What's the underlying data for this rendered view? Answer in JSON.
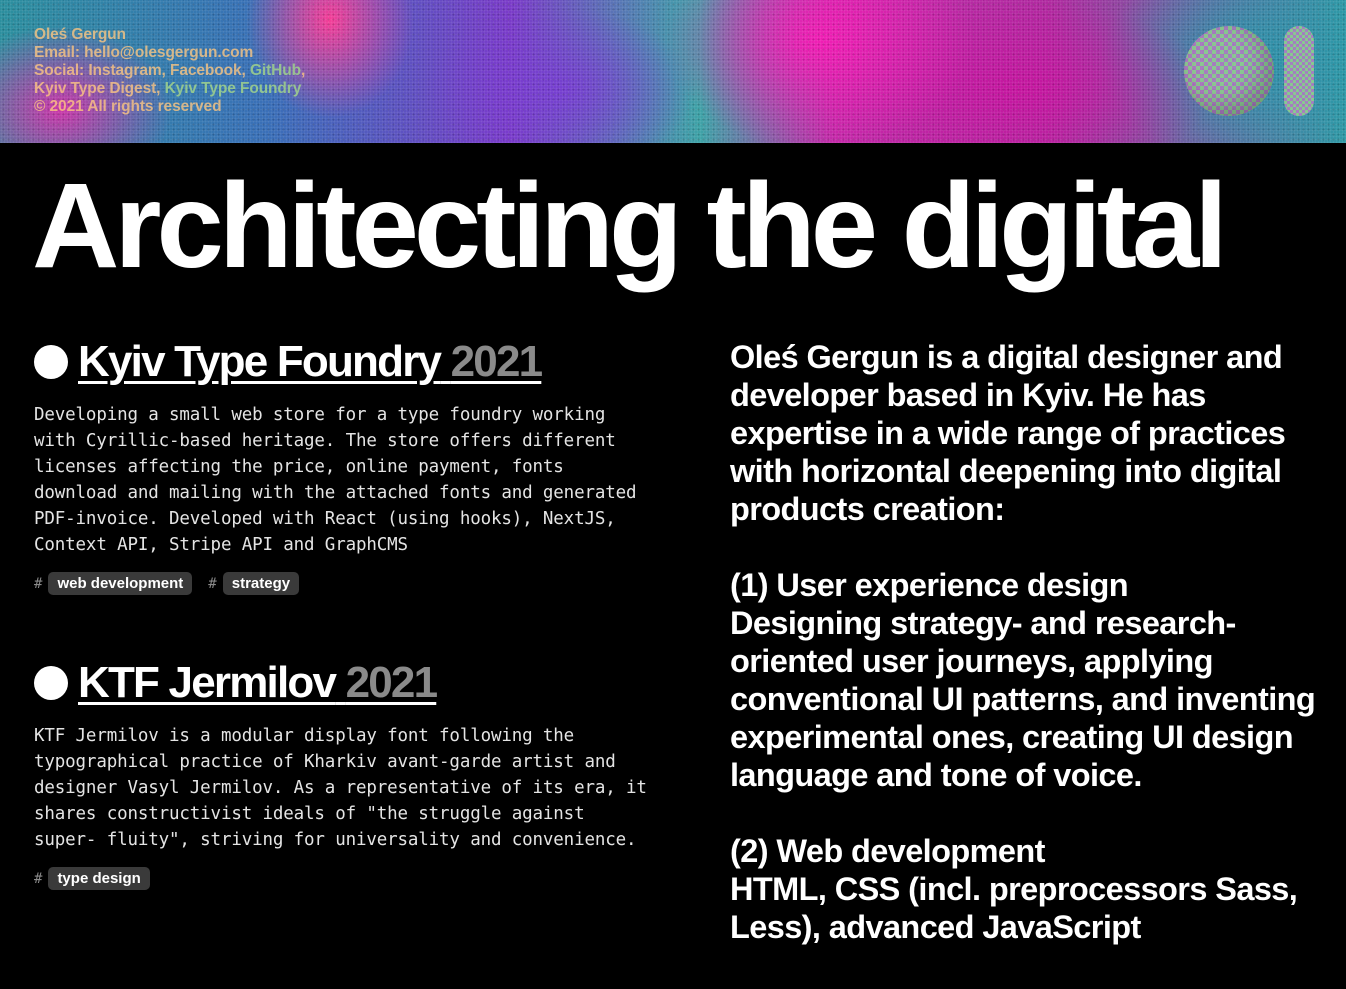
{
  "header": {
    "name": "Oleś Gergun",
    "email_label": "Email:",
    "email": "hello@olesgergun.com",
    "social_label": "Social:",
    "social_links": [
      "Instagram",
      "Facebook",
      "GitHub"
    ],
    "org_links": [
      "Kyiv Type Digest",
      "Kyiv Type Foundry"
    ],
    "copyright": "© 2021 All rights reserved",
    "logo_icon": "checkered-sphere-logo-icon"
  },
  "headline": "Architecting the digital",
  "projects": [
    {
      "title": "Kyiv Type Foundry",
      "year": "2021",
      "description": "Developing a small web store for a type foundry working with Cyrillic-based heritage. The store offers different licenses affecting the price, online payment, fonts download and mailing with the attached fonts and generated PDF-invoice. Developed with React (using hooks), NextJS, Context API, Stripe API and GraphCMS",
      "tags": [
        "web development",
        "strategy"
      ]
    },
    {
      "title": "KTF Jermilov",
      "year": "2021",
      "description": "KTF Jermilov is a modular display font following the typographical practice of Kharkiv avant-garde artist and designer Vasyl Jermilov. As a representative of its era, it shares constructivist ideals of \"the struggle against super- fluity\", striving for universality and convenience.",
      "tags": [
        "type design"
      ]
    }
  ],
  "bio": {
    "intro": "Oleś Gergun is a digital designer and developer based in Kyiv. He has expertise in a wide range of practices with horizontal deepening into digital products creation:",
    "sections": [
      {
        "title": "(1) User experience design",
        "body": "Designing strategy- and research-oriented user journeys, applying conventional UI patterns, and inventing experimental ones, creating UI design language and tone of voice."
      },
      {
        "title": "(2) Web development",
        "body": "HTML, CSS (incl. preprocessors Sass, Less), advanced JavaScript"
      }
    ]
  },
  "tag_hash": "#"
}
